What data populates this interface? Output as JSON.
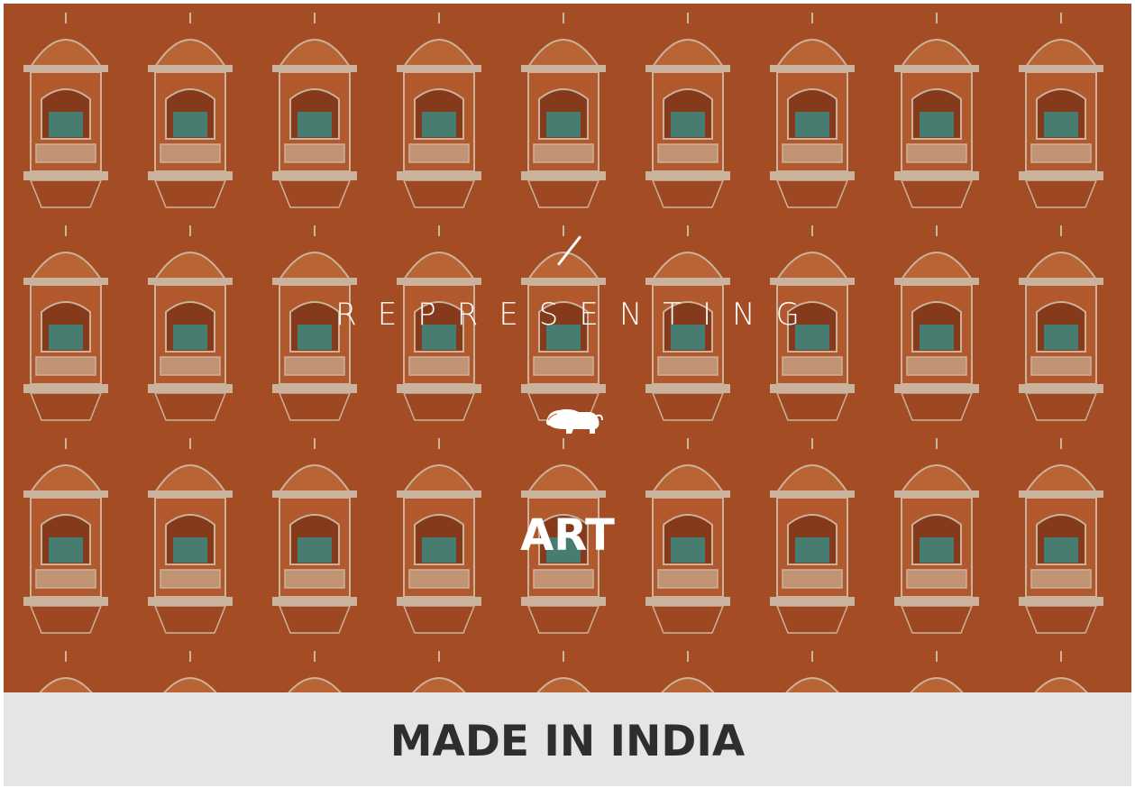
{
  "hero": {
    "kicker": "REPRESENTING",
    "category": "ART",
    "logo_text": "MADE IN INDIA",
    "image_subject": "facade-with-latticed-windows",
    "colors": {
      "wall": "#c9652c",
      "trim": "#f0d6bf",
      "window": "#3fa39a",
      "text": "#ffffff"
    }
  },
  "footer": {
    "title": "MADE IN INDIA",
    "background": "#e5e5e5",
    "text_color": "#2e2e2e"
  }
}
